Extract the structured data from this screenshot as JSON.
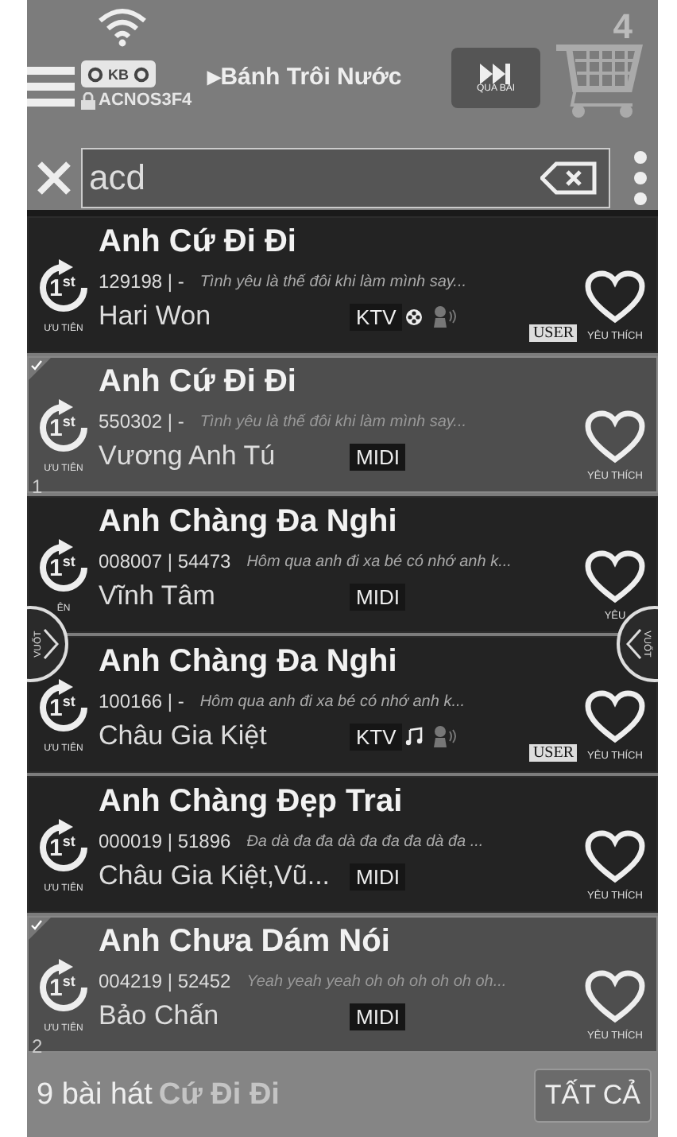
{
  "header": {
    "logo_text": "KB",
    "lock_code": "ACNOS3F4",
    "now_playing_marker": "▶",
    "now_playing": "Bánh Trôi Nước",
    "skip_label": "QUA BÀI",
    "cart_count": "4"
  },
  "search": {
    "value": "acd"
  },
  "swipe": {
    "left_label": "VUỐT",
    "right_label": "VUỐT"
  },
  "songs": [
    {
      "title": "Anh Cứ Đi Đi",
      "badge": "1$^{st}$",
      "code": "129198 | -",
      "lyric": "Tình yêu là thế đôi khi làm mình say...",
      "singer": "Hari Won",
      "kind": "ktv_reel",
      "tag": "KTV",
      "user": "USER",
      "priority_label": "ƯU TIÊN",
      "fav_label": "YÊU THÍCH",
      "selected": false
    },
    {
      "title": "Anh Cứ Đi Đi",
      "badge": "1$^{st}$",
      "code": "550302 | -",
      "lyric": "Tình yêu là thế đôi khi làm mình say...",
      "singer": "Vương Anh Tú",
      "kind": "midi",
      "tag": "MIDI",
      "priority_label": "ƯU TIÊN",
      "priority_number": "1",
      "fav_label": "YÊU THÍCH",
      "selected": true
    },
    {
      "title": "Anh Chàng Đa Nghi",
      "badge": "1$^{st}$",
      "code": "008007 | 54473",
      "lyric": "Hôm qua anh đi xa bé có nhớ anh k...",
      "singer": "Vĩnh Tâm",
      "kind": "midi",
      "tag": "MIDI",
      "priority_label": "ÊN",
      "fav_label": "YÊU",
      "selected": false
    },
    {
      "title": "Anh Chàng Đa Nghi",
      "badge": "1$^{st}$",
      "code": "100166 | -",
      "lyric": "Hôm qua anh đi xa bé có nhớ anh k...",
      "singer": "Châu Gia Kiệt",
      "kind": "ktv_note",
      "tag": "KTV",
      "user": "USER",
      "priority_label": "ƯU TIÊN",
      "fav_label": "YÊU THÍCH",
      "selected": false
    },
    {
      "title": "Anh Chàng Đẹp Trai",
      "badge": "1$^{st}$",
      "code": "000019 | 51896",
      "lyric": "Đa dà đa đa dà đa đa đa dà đa ...",
      "singer": "Châu Gia Kiệt,Vũ...",
      "kind": "midi",
      "tag": "MIDI",
      "priority_label": "ƯU TIÊN",
      "fav_label": "YÊU THÍCH",
      "selected": false
    },
    {
      "title": "Anh Chưa Dám Nói",
      "badge": "1$^{st}$",
      "code": "004219 | 52452",
      "lyric": "Yeah yeah yeah oh oh oh oh oh oh...",
      "singer": "Bảo Chấn",
      "kind": "midi",
      "tag": "MIDI",
      "priority_label": "ƯU TIÊN",
      "priority_number": "2",
      "fav_label": "YÊU THÍCH",
      "selected": true
    }
  ],
  "footer": {
    "count": "9 bài hát",
    "hidden_title": "Cứ Đi Đi",
    "all_button": "TẤT CẢ"
  }
}
